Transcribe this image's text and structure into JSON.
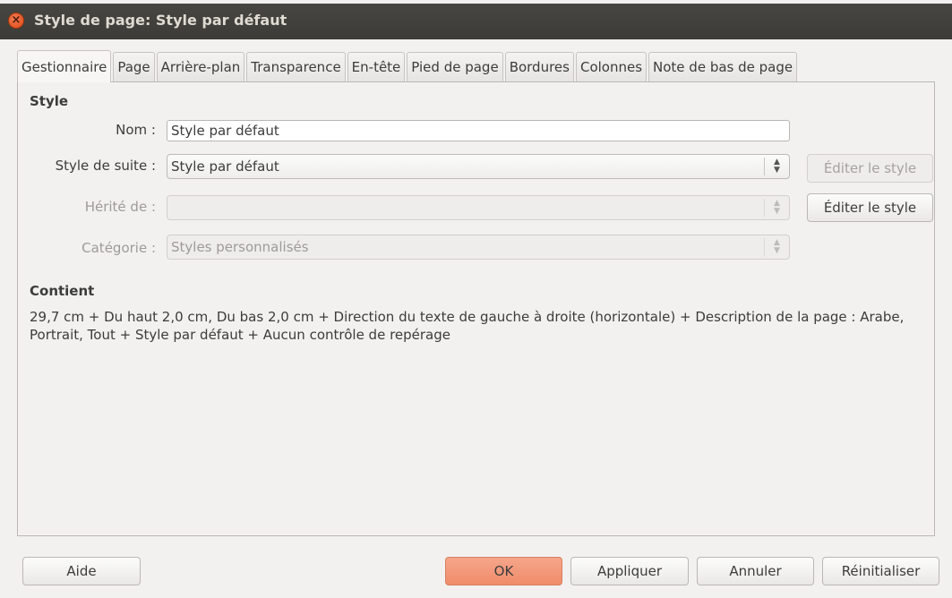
{
  "window": {
    "title": "Style de page: Style par défaut"
  },
  "tabs": [
    {
      "label": "Gestionnaire"
    },
    {
      "label": "Page"
    },
    {
      "label": "Arrière-plan"
    },
    {
      "label": "Transparence"
    },
    {
      "label": "En-tête"
    },
    {
      "label": "Pied de page"
    },
    {
      "label": "Bordures"
    },
    {
      "label": "Colonnes"
    },
    {
      "label": "Note de bas de page"
    }
  ],
  "style_section": {
    "heading": "Style",
    "name_label": "Nom :",
    "name_value": "Style par défaut",
    "next_style_label": "Style de suite :",
    "next_style_value": "Style par défaut",
    "edit_style_label_1": "Éditer le style",
    "inherited_label": "Hérité de :",
    "inherited_value": "",
    "edit_style_label_2": "Éditer le style",
    "category_label": "Catégorie :",
    "category_value": "Styles personnalisés"
  },
  "contains_section": {
    "heading": "Contient",
    "text": "29,7 cm + Du haut 2,0 cm, Du bas 2,0 cm + Direction du texte de gauche à droite (horizontale) + Description de la page : Arabe, Portrait, Tout + Style par défaut + Aucun contrôle de repérage"
  },
  "footer": {
    "help": "Aide",
    "ok": "OK",
    "apply": "Appliquer",
    "cancel": "Annuler",
    "reset": "Réinitialiser"
  },
  "colors": {
    "accent": "#ef8c6a",
    "titlebar": "#3c3b37"
  }
}
